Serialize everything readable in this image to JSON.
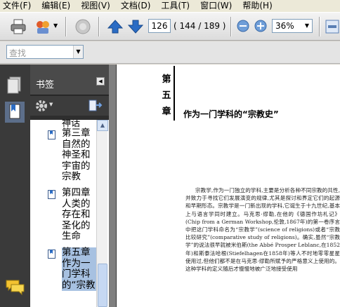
{
  "menu": [
    "文件(F)",
    "编辑(E)",
    "视图(V)",
    "文档(D)",
    "工具(T)",
    "窗口(W)",
    "帮助(H)"
  ],
  "toolbar": {
    "page_number": "126",
    "page_count": "( 144 / 189 )",
    "zoom": "36%"
  },
  "search": {
    "placeholder": "查找"
  },
  "bookmarks": {
    "title": "书签",
    "prev_fragment": "神话",
    "items": [
      {
        "label": "第三章 自然的神圣和宇宙的宗教",
        "selected": false
      },
      {
        "label": "第四章 人类的存在和圣化的生命",
        "selected": false
      },
      {
        "label": "第五章 作为一门学科的“宗教",
        "selected": true
      }
    ]
  },
  "document": {
    "chapter_chars": [
      "第",
      "五",
      "章"
    ],
    "chapter_title": "作为一门学科的“宗教史”",
    "body": "宗教学,作为一门独立的学科,主要是分析各种不同宗教的共性,并致力于寻找它们发展演变的规律,尤其是探讨和界定它们的起源和早期形态。宗教学是一门新出现的学科,它诞生于十九世纪,基本上与语言学同时建立。马克思·缪勒,在他的《德国作坊札记》(Chip from a German Workshop,伦敦,1867年)的第一卷序言中把这门学科命名为“宗教学”(science of religions)或者“宗教比较研究”(comparative study of religions)。确实,虽然“宗教学”的说法很早就被米伯斯(the Abbé Prosper Leblanc,在1852年)和斯泰法哈根(Stiefelhagen在1858年)等人不时地零零星星使用过,但他们都不是在马克思·缪勒所赋予的严格意义上使用的。这种学科的定义随后才慢慢地被广泛地接受使用"
  },
  "colors": {
    "panel_dark": "#2e2e2e",
    "selection": "#a7c1e1",
    "arrow_blue": "#2b6cc4"
  }
}
